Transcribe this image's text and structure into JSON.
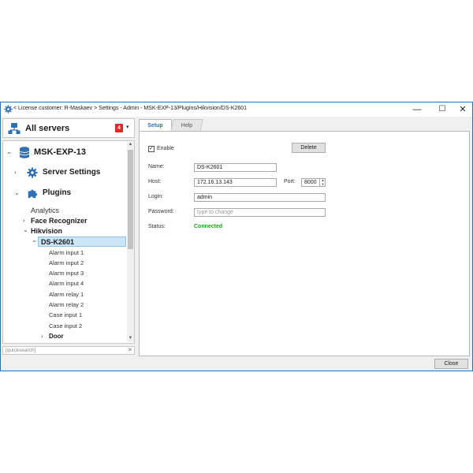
{
  "window": {
    "title": "< License customer: R-Maskaev > Settings - Admin - MSK-EXP-13/Plugins/Hikvision/DS-K2601",
    "controls": {
      "minimize": "—",
      "maximize": "☐",
      "close": "✕"
    }
  },
  "servers": {
    "label": "All servers",
    "badge": "4",
    "caret": "▾"
  },
  "tree": {
    "server": "MSK-EXP-13",
    "server_settings": "Server Settings",
    "plugins": "Plugins",
    "analytics": "Analytics",
    "face_recognizer": "Face Recognizer",
    "hikvision": "Hikvision",
    "device": "DS-K2601",
    "leaves": [
      "Alarm input 1",
      "Alarm input 2",
      "Alarm input 3",
      "Alarm input 4",
      "Alarm relay 1",
      "Alarm relay 2",
      "Case input 1",
      "Case input 2"
    ],
    "door": "Door"
  },
  "quicksearch": {
    "placeholder": "[quicksearch]",
    "clear": "✕"
  },
  "tabs": {
    "setup": "Setup",
    "help": "Help"
  },
  "form": {
    "enable_label": "Enable",
    "enable_checked": true,
    "delete_button": "Delete",
    "name_label": "Name:",
    "name_value": "DS-K2601",
    "host_label": "Host:",
    "host_value": "172.16.13.143",
    "port_label": "Port:",
    "port_value": "8000",
    "login_label": "Login:",
    "login_value": "admin",
    "password_label": "Password:",
    "password_placeholder": "type to change",
    "status_label": "Status:",
    "status_value": "Connected"
  },
  "footer": {
    "close_button": "Close"
  },
  "colors": {
    "accent": "#2f6fb4",
    "badge": "#d92b2b",
    "connected": "#1aa01a",
    "selection": "#cde6f7"
  },
  "icons": {
    "title": "gear-icon",
    "servers": "servers-icon",
    "database": "database-icon",
    "settings": "gear-icon",
    "plugins": "puzzle-icon"
  }
}
